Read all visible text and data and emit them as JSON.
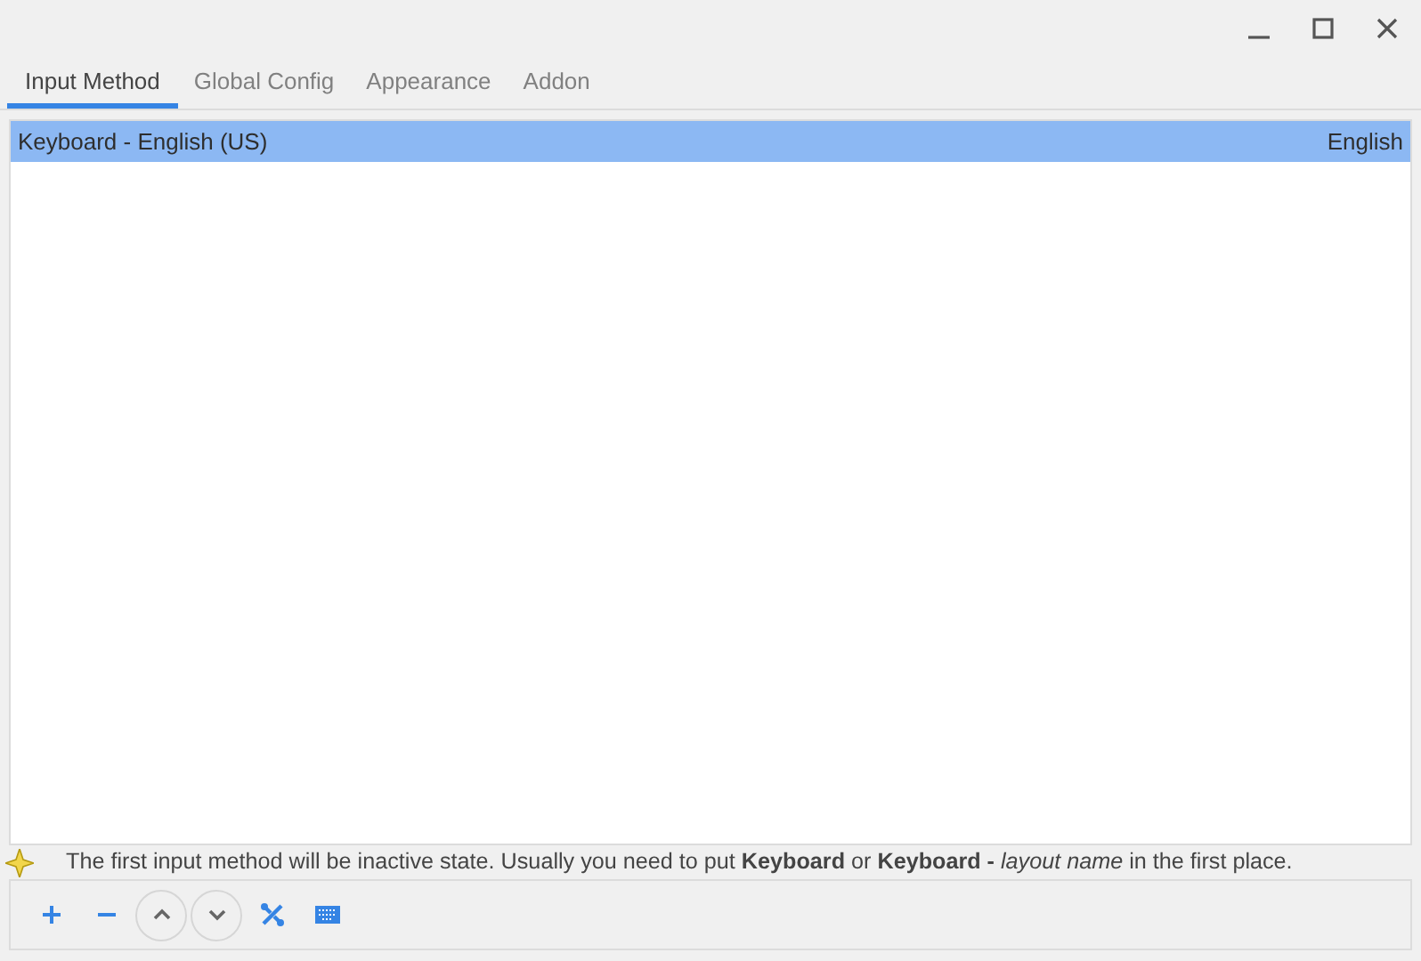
{
  "window_controls": [
    {
      "kind": "minimize"
    },
    {
      "kind": "maximize"
    },
    {
      "kind": "close"
    }
  ],
  "tabs": [
    {
      "label": "Input Method",
      "selected": true
    },
    {
      "label": "Global Config",
      "selected": false
    },
    {
      "label": "Appearance",
      "selected": false
    },
    {
      "label": "Addon",
      "selected": false
    }
  ],
  "input_methods": [
    {
      "name": "Keyboard - English (US)",
      "language": "English",
      "selected": true
    }
  ],
  "hint": "The first input method will be inactive state. Usually you need to put **Keyboard** or **Keyboard -** *layout name* in the first place.",
  "toolbar": [
    {
      "kind": "add"
    },
    {
      "kind": "remove"
    },
    {
      "kind": "up"
    },
    {
      "kind": "down"
    },
    {
      "kind": "configure"
    },
    {
      "kind": "keyboard"
    }
  ]
}
